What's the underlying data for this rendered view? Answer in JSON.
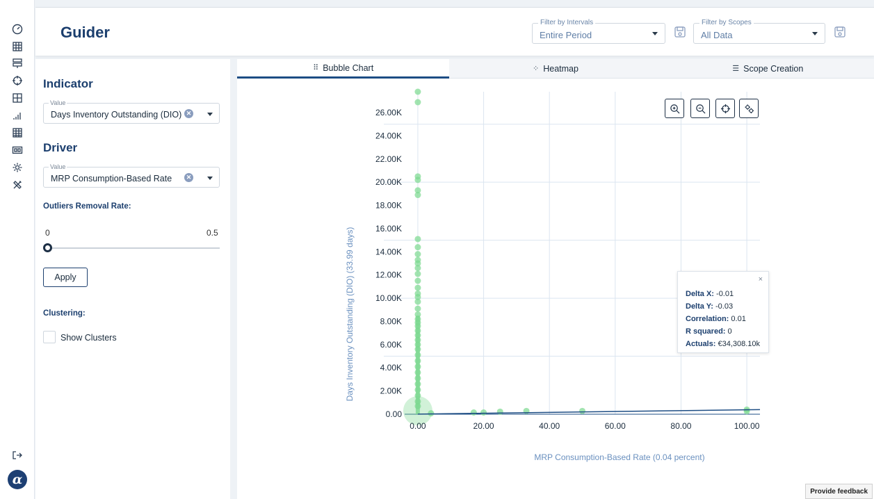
{
  "app": {
    "title": "Guider"
  },
  "filters": {
    "intervals": {
      "label": "Filter by Intervals",
      "value": "Entire Period"
    },
    "scopes": {
      "label": "Filter by Scopes",
      "value": "All Data"
    }
  },
  "panel": {
    "indicator": {
      "title": "Indicator",
      "field_label": "Value",
      "value": "Days Inventory Outstanding (DIO)"
    },
    "driver": {
      "title": "Driver",
      "field_label": "Value",
      "value": "MRP Consumption-Based Rate"
    },
    "outliers": {
      "title": "Outliers Removal Rate:",
      "min_label": "0",
      "max_label": "0.5",
      "value": 0
    },
    "apply_label": "Apply",
    "clustering": {
      "title": "Clustering:",
      "show_clusters_label": "Show Clusters",
      "checked": false
    }
  },
  "tabs": [
    {
      "label": "Bubble Chart",
      "active": true,
      "icon": "bubble-chart-icon"
    },
    {
      "label": "Heatmap",
      "active": false,
      "icon": "heatmap-icon"
    },
    {
      "label": "Scope Creation",
      "active": false,
      "icon": "scope-list-icon"
    }
  ],
  "toolbar": {
    "buttons": [
      "zoom-in-icon",
      "zoom-out-icon",
      "crosshair-icon",
      "settings-gears-icon"
    ]
  },
  "stats": {
    "delta_x_label": "Delta X:",
    "delta_x": "-0.01",
    "delta_y_label": "Delta Y:",
    "delta_y": "-0.03",
    "correlation_label": "Correlation:",
    "correlation": "0.01",
    "r_squared_label": "R squared:",
    "r_squared": "0",
    "actuals_label": "Actuals:",
    "actuals": "€34,308.10k",
    "close": "×"
  },
  "feedback_label": "Provide feedback",
  "sidebar_icons": [
    "dashboard-icon",
    "grid-icon",
    "layers-icon",
    "target-icon",
    "table-icon",
    "bar-signal-icon",
    "spreadsheet-icon",
    "card-icon",
    "settings-icon",
    "tools-icon",
    "logout-icon"
  ],
  "colors": {
    "brand": "#1c3f6e",
    "bubble": "#7bd88f",
    "trend": "#1d4d84"
  },
  "chart_data": {
    "type": "scatter",
    "xlabel": "MRP Consumption-Based Rate (0.04 percent)",
    "ylabel": "Days Inventory Outstanding (DIO) (33.99 days)",
    "x_ticks": [
      "0.00",
      "20.00",
      "40.00",
      "60.00",
      "80.00",
      "100.00"
    ],
    "y_ticks": [
      "0.00",
      "2.00K",
      "4.00K",
      "6.00K",
      "8.00K",
      "10.00K",
      "12.00K",
      "14.00K",
      "16.00K",
      "18.00K",
      "20.00K",
      "22.00K",
      "24.00K",
      "26.00K"
    ],
    "xlim": [
      -4,
      104
    ],
    "ylim": [
      0,
      27800
    ],
    "grid": true,
    "points": [
      {
        "x": 0,
        "y": 27800
      },
      {
        "x": 0,
        "y": 26900
      },
      {
        "x": 0,
        "y": 20500
      },
      {
        "x": 0,
        "y": 20200
      },
      {
        "x": 0,
        "y": 19300
      },
      {
        "x": 0,
        "y": 18900
      },
      {
        "x": 0,
        "y": 15100
      },
      {
        "x": 0,
        "y": 14400
      },
      {
        "x": 0,
        "y": 13800
      },
      {
        "x": 0,
        "y": 13300
      },
      {
        "x": 0,
        "y": 13000
      },
      {
        "x": 0,
        "y": 12600
      },
      {
        "x": 0,
        "y": 12100
      },
      {
        "x": 0,
        "y": 11500
      },
      {
        "x": 0,
        "y": 10900
      },
      {
        "x": 0,
        "y": 10400
      },
      {
        "x": 0,
        "y": 10100
      },
      {
        "x": 0,
        "y": 9700
      },
      {
        "x": 0,
        "y": 9100
      },
      {
        "x": 0,
        "y": 8600
      },
      {
        "x": 0,
        "y": 8200
      },
      {
        "x": 0,
        "y": 7900
      },
      {
        "x": 0,
        "y": 7600
      },
      {
        "x": 0,
        "y": 7200
      },
      {
        "x": 0,
        "y": 6800
      },
      {
        "x": 0,
        "y": 6400
      },
      {
        "x": 0,
        "y": 6000
      },
      {
        "x": 0,
        "y": 5600
      },
      {
        "x": 0,
        "y": 5100
      },
      {
        "x": 0,
        "y": 4600
      },
      {
        "x": 0,
        "y": 4100
      },
      {
        "x": 0,
        "y": 3600
      },
      {
        "x": 0,
        "y": 3100
      },
      {
        "x": 0,
        "y": 2600
      },
      {
        "x": 0,
        "y": 2100
      },
      {
        "x": 0,
        "y": 1600
      },
      {
        "x": 0,
        "y": 1100
      },
      {
        "x": 0,
        "y": 700
      },
      {
        "x": 0,
        "y": 300,
        "size": "large"
      },
      {
        "x": 4,
        "y": 80
      },
      {
        "x": 17,
        "y": 150
      },
      {
        "x": 20,
        "y": 150
      },
      {
        "x": 25,
        "y": 220
      },
      {
        "x": 33,
        "y": 280
      },
      {
        "x": 50,
        "y": 280
      },
      {
        "x": 100,
        "y": 400
      },
      {
        "x": 100,
        "y": 250
      }
    ],
    "trendline": {
      "x": [
        0,
        104
      ],
      "y": [
        10,
        400
      ]
    }
  }
}
